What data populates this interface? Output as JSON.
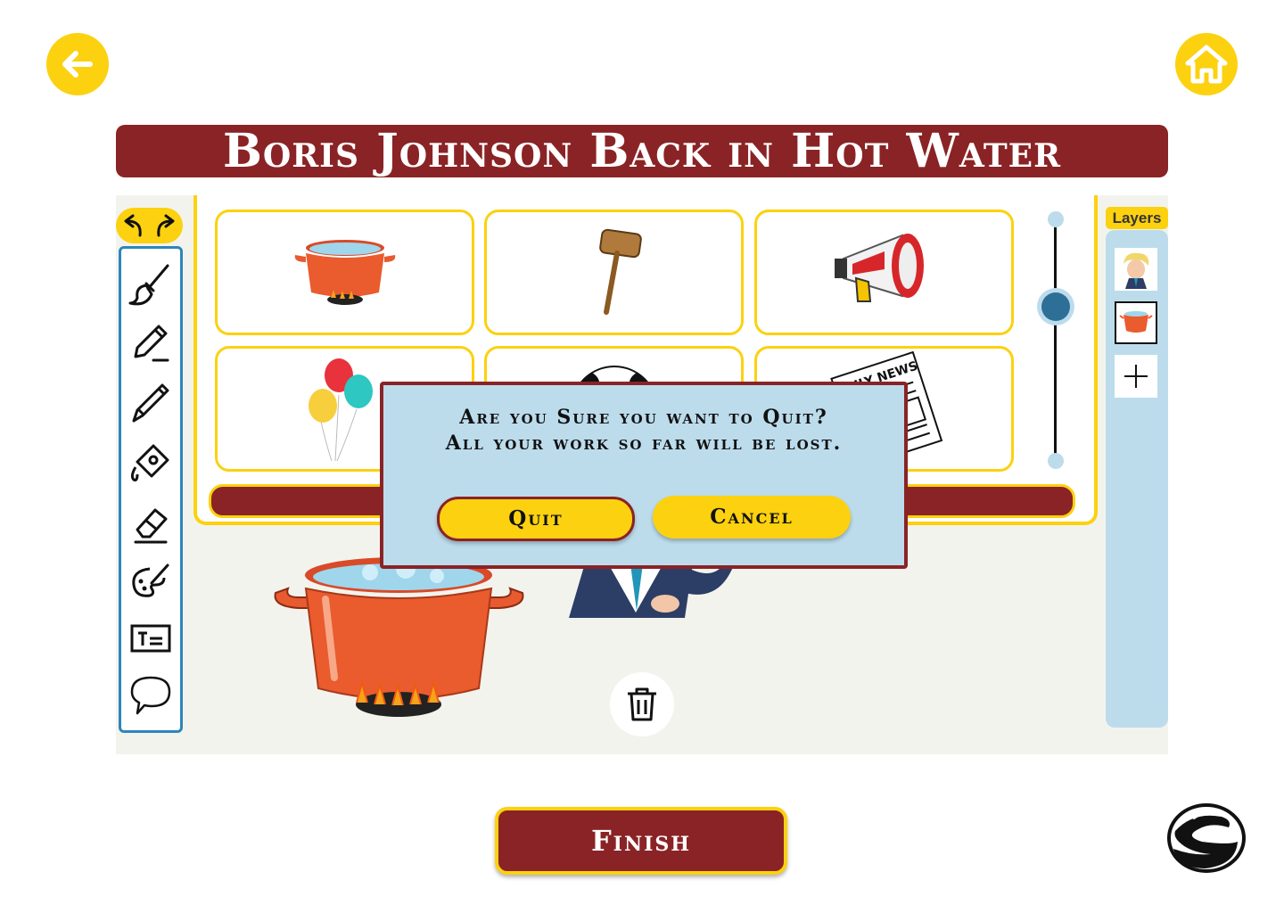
{
  "nav": {
    "back_icon": "arrow-left-icon",
    "home_icon": "home-icon"
  },
  "title": "Boris Johnson Back in Hot Water",
  "editor": {
    "undo_icon": "undo-icon",
    "redo_icon": "redo-icon",
    "tools": [
      {
        "name": "brush-tool",
        "icon": "paintbrush-icon"
      },
      {
        "name": "pencil-tool",
        "icon": "pencil-icon"
      },
      {
        "name": "pen-tool",
        "icon": "pen-icon"
      },
      {
        "name": "fill-tool",
        "icon": "paint-bucket-icon"
      },
      {
        "name": "eraser-tool",
        "icon": "eraser-icon"
      },
      {
        "name": "palette-tool",
        "icon": "palette-icon"
      },
      {
        "name": "text-tool",
        "icon": "text-box-icon"
      },
      {
        "name": "speech-tool",
        "icon": "speech-bubble-icon"
      }
    ],
    "stickers": [
      {
        "name": "cooking-pot-sticker"
      },
      {
        "name": "gavel-sticker"
      },
      {
        "name": "megaphone-sticker"
      },
      {
        "name": "balloons-sticker"
      },
      {
        "name": "football-sticker"
      },
      {
        "name": "newspaper-sticker",
        "text": "DAILY NEWS"
      }
    ],
    "size_slider_value": 0.36,
    "delete_icon": "trash-icon"
  },
  "layers": {
    "label": "Layers",
    "items": [
      {
        "name": "layer-boris"
      },
      {
        "name": "layer-pot",
        "selected": true
      }
    ],
    "add_icon": "plus-icon"
  },
  "dialog": {
    "line1": "Are you Sure you want to Quit?",
    "line2": "All your work so far will be lost.",
    "quit_label": "Quit",
    "cancel_label": "Cancel"
  },
  "finish_label": "Finish",
  "logo_icon": "brand-logo-icon",
  "colors": {
    "accent_yellow": "#fcd10f",
    "brand_maroon": "#8a2325",
    "panel_blue": "#bcdcec",
    "tool_border_blue": "#2d86b9"
  }
}
